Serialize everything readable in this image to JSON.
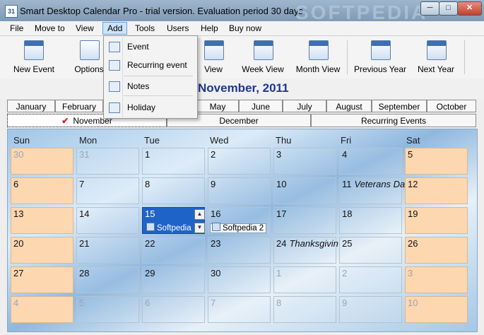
{
  "window": {
    "title": "Smart Desktop Calendar Pro - trial version. Evaluation period 30 days.",
    "watermark": "SOFTPEDIA"
  },
  "menu": [
    "File",
    "Move to",
    "View",
    "Add",
    "Tools",
    "Users",
    "Help",
    "Buy now"
  ],
  "add_menu": {
    "items": [
      "Event",
      "Recurring event",
      "Notes",
      "Holiday"
    ]
  },
  "toolbar": {
    "new_event": "New Event",
    "options": "Options",
    "view": "View",
    "week_view": "Week View",
    "month_view": "Month View",
    "previous_year": "Previous Year",
    "next_year": "Next Year"
  },
  "month_title": "November, 2011",
  "month_tabs": [
    "January",
    "February",
    "May",
    "June",
    "July",
    "August",
    "September",
    "October"
  ],
  "sub_tabs": {
    "november": "November",
    "december": "December",
    "recurring": "Recurring Events"
  },
  "day_headers": [
    "Sun",
    "Mon",
    "Tue",
    "Wed",
    "Thu",
    "Fri",
    "Sat"
  ],
  "weeks": [
    [
      "30",
      "31",
      "1",
      "2",
      "3",
      "4",
      "5"
    ],
    [
      "6",
      "7",
      "8",
      "9",
      "10",
      "11",
      "12"
    ],
    [
      "13",
      "14",
      "15",
      "16",
      "17",
      "18",
      "19"
    ],
    [
      "20",
      "21",
      "22",
      "23",
      "24",
      "25",
      "26"
    ],
    [
      "27",
      "28",
      "29",
      "30",
      "1",
      "2",
      "3"
    ],
    [
      "4",
      "5",
      "6",
      "7",
      "8",
      "9",
      "10"
    ]
  ],
  "cell_text": {
    "veterans": "Veterans Da",
    "thanksgiving": "Thanksgivin"
  },
  "events": {
    "e15": "Softpedia",
    "e16": "Softpedia 2"
  },
  "colors": {
    "selected": "#1e63c8",
    "weekend": "#fcd7b0",
    "month_title": "#1f3790"
  }
}
